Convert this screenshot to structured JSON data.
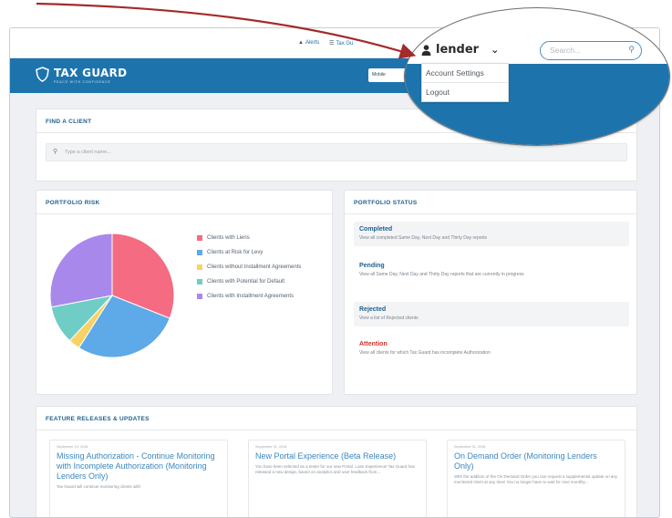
{
  "topbar": {
    "alerts_label": "Alerts",
    "tax_label": "Tax Gu"
  },
  "header": {
    "brand": "TAX GUARD",
    "tagline": "PEACE WITH CONFIDENCE",
    "button_label": "Mobile"
  },
  "find_client": {
    "title": "FIND A CLIENT",
    "placeholder": "Type a client name..."
  },
  "portfolio_risk": {
    "title": "PORTFOLIO RISK"
  },
  "chart_data": {
    "type": "pie",
    "categories": [
      "Clients with Liens",
      "Clients at Risk for Levy",
      "Clients without Installment Agreements",
      "Clients with Potential for Default",
      "Clients with Installment Agreements"
    ],
    "values": [
      31,
      28,
      3,
      10,
      28
    ],
    "colors": [
      "#f46b82",
      "#5ea9e7",
      "#f9d266",
      "#6fcdc6",
      "#a988ec"
    ]
  },
  "portfolio_status": {
    "title": "PORTFOLIO STATUS",
    "items": [
      {
        "heading": "Completed",
        "text": "View all completed Same Day, Next Day and Thirty Day reports"
      },
      {
        "heading": "Pending",
        "text": "View all Same Day, Next Day and Thirty Day reports that are currently in progress"
      },
      {
        "heading": "Rejected",
        "text": "View a list of Rejected clients"
      },
      {
        "heading": "Attention",
        "text": "View all clients for which Tax Guard has incomplete Authorization"
      }
    ]
  },
  "releases": {
    "title": "FEATURE RELEASES & UPDATES",
    "items": [
      {
        "date": "September 10, 2018",
        "title": "Missing Authorization - Continue Monitoring with Incomplete Authorization (Monitoring Lenders Only)",
        "body": "Tax Guard will continue monitoring clients with"
      },
      {
        "date": "September 01, 2018",
        "title": "New Portal Experience (Beta Release)",
        "body": "You have been selected as a tester for our new Portal. Loan Experience! Tax Guard has released a new design, based on analytics and user feedback from..."
      },
      {
        "date": "September 01, 2018",
        "title": "On Demand Order (Monitoring Lenders Only)",
        "body": "With the addition of the On Demand Order you can request a supplemental update on any monitored client at any time! You no longer have to wait for next monthly..."
      }
    ]
  },
  "magnifier": {
    "user_label": "lender",
    "search_placeholder": "Search...",
    "top_text": "Tax Guard",
    "menu": [
      "Account Settings",
      "Logout"
    ]
  },
  "colors": {
    "brand_blue": "#1d74ad",
    "arrow": "#a52a2a",
    "accent_orange": "#f2a12b"
  }
}
